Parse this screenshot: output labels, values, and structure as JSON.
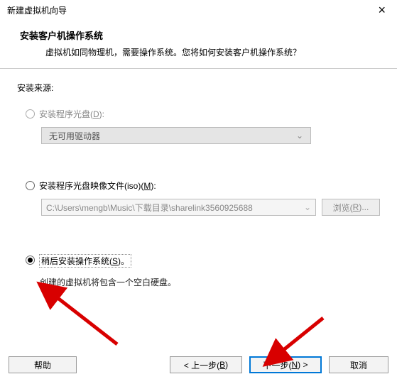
{
  "window": {
    "title": "新建虚拟机向导",
    "close_glyph": "×"
  },
  "header": {
    "title": "安装客户机操作系统",
    "description": "虚拟机如同物理机，需要操作系统。您将如何安装客户机操作系统？"
  },
  "body": {
    "source_label": "安装来源:",
    "opt_disc": {
      "label_pre": "安装程序光盘(",
      "accel": "D",
      "label_post": "):"
    },
    "disc_select": "无可用驱动器",
    "chevron": "⌄",
    "opt_iso": {
      "label_pre": "安装程序光盘映像文件(iso)(",
      "accel": "M",
      "label_post": "):"
    },
    "iso_path": "C:\\Users\\mengb\\Music\\下载目录\\sharelink3560925688",
    "browse_pre": "浏览(",
    "browse_accel": "R",
    "browse_post": ")...",
    "opt_later": {
      "label_pre": "稍后安装操作系统(",
      "accel": "S",
      "label_post": ")。"
    },
    "later_hint": "创建的虚拟机将包含一个空白硬盘。"
  },
  "footer": {
    "help": "帮助",
    "back_pre": "< 上一步(",
    "back_accel": "B",
    "back_post": ")",
    "next_pre": "下一步(",
    "next_accel": "N",
    "next_post": ") >",
    "cancel": "取消"
  }
}
